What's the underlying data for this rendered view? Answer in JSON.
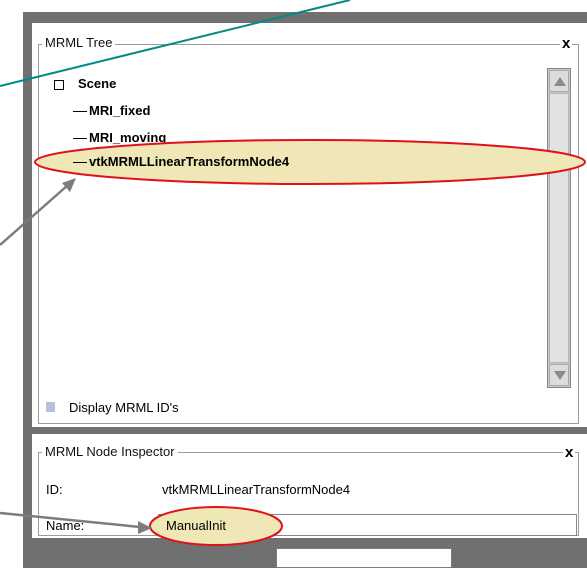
{
  "colors": {
    "frame": "#707070",
    "highlight_fill": "#efe7b5",
    "highlight_stroke": "#e0101c",
    "teal_line": "#008a8a",
    "gray_arrow": "#7c7c7c"
  },
  "mrml_tree": {
    "title": "MRML Tree",
    "close_icon": "close-icon",
    "close_glyph": "x",
    "items": [
      {
        "label": "Scene",
        "bold": true,
        "has_checkbox": true
      },
      {
        "label": "MRI_fixed",
        "bold": true,
        "has_checkbox": false
      },
      {
        "label": "MRI_moving",
        "bold": true,
        "has_checkbox": false
      },
      {
        "label": "vtkMRMLLinearTransformNode4",
        "bold": true,
        "has_checkbox": false,
        "highlighted": true
      }
    ],
    "display_ids_label": "Display MRML ID's"
  },
  "inspector": {
    "title": "MRML Node Inspector",
    "close_glyph": "x",
    "id_label": "ID:",
    "id_value": "vtkMRMLLinearTransformNode4",
    "name_label": "Name:",
    "name_value": "ManualInit"
  }
}
